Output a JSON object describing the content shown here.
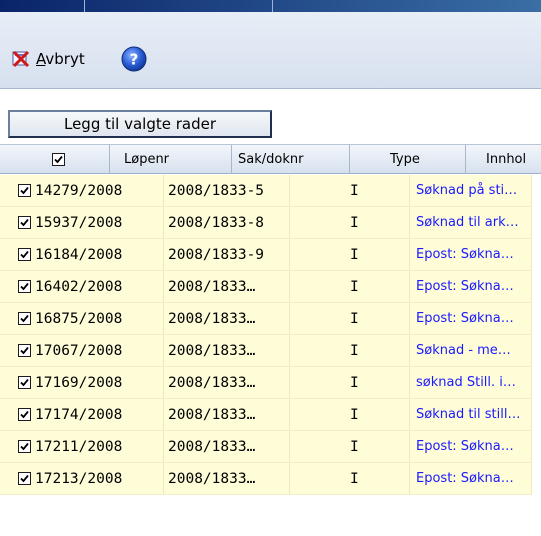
{
  "toolbar": {
    "cancel_label_first": "A",
    "cancel_label_rest": "vbryt",
    "add_rows_label": "Legg til valgte rader"
  },
  "grid": {
    "columns": {
      "check": "",
      "lopenr": "Løpenr",
      "sakdoknr": "Sak/doknr",
      "type": "Type",
      "innhold": "Innhol"
    },
    "rows": [
      {
        "checked": true,
        "lopenr": "14279/2008",
        "sak": "2008/1833-5",
        "type": "I",
        "innhold": "Søknad på sti…"
      },
      {
        "checked": true,
        "lopenr": "15937/2008",
        "sak": "2008/1833-8",
        "type": "I",
        "innhold": "Søknad til ark…"
      },
      {
        "checked": true,
        "lopenr": "16184/2008",
        "sak": "2008/1833-9",
        "type": "I",
        "innhold": "Epost: Søkna…"
      },
      {
        "checked": true,
        "lopenr": "16402/2008",
        "sak": "2008/1833…",
        "type": "I",
        "innhold": "Epost: Søkna…"
      },
      {
        "checked": true,
        "lopenr": "16875/2008",
        "sak": "2008/1833…",
        "type": "I",
        "innhold": "Epost: Søkna…"
      },
      {
        "checked": true,
        "lopenr": "17067/2008",
        "sak": "2008/1833…",
        "type": "I",
        "innhold": "Søknad - me…"
      },
      {
        "checked": true,
        "lopenr": "17169/2008",
        "sak": "2008/1833…",
        "type": "I",
        "innhold": "søknad Still. i…"
      },
      {
        "checked": true,
        "lopenr": "17174/2008",
        "sak": "2008/1833…",
        "type": "I",
        "innhold": "Søknad til still…"
      },
      {
        "checked": true,
        "lopenr": "17211/2008",
        "sak": "2008/1833…",
        "type": "I",
        "innhold": "Epost: Søkna…"
      },
      {
        "checked": true,
        "lopenr": "17213/2008",
        "sak": "2008/1833…",
        "type": "I",
        "innhold": "Epost: Søkna…"
      }
    ]
  },
  "icons": {
    "cancel": "cancel-icon",
    "help": "help-icon",
    "checkbox": "checkbox-checked-icon"
  },
  "colors": {
    "row_bg": "#fffcd8",
    "link_text": "#1a1aff",
    "titlebar": "#0a246a"
  }
}
